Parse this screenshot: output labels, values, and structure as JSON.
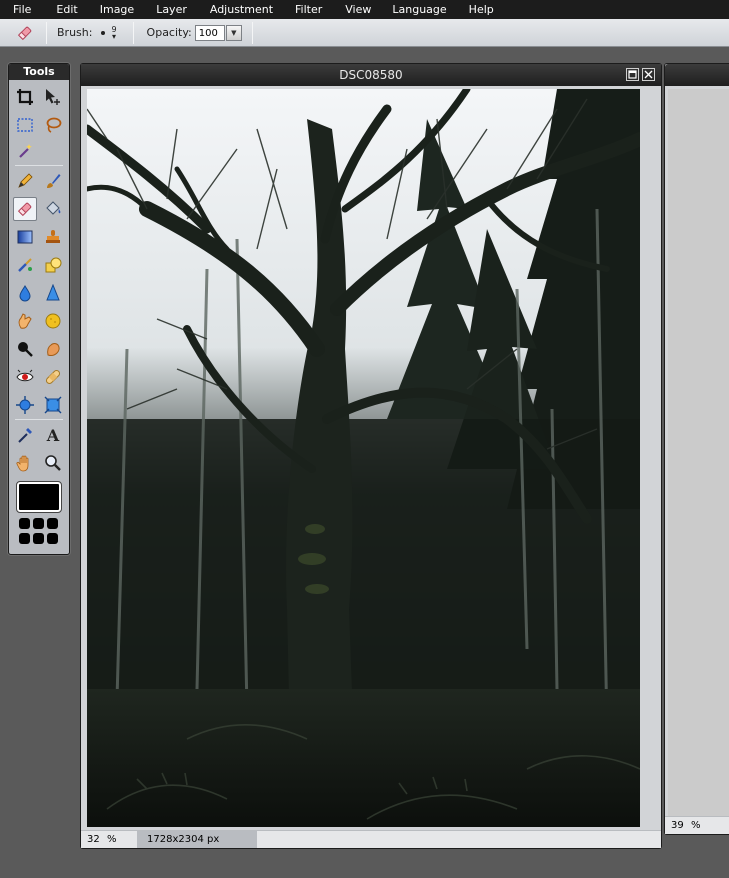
{
  "menu": [
    "File",
    "Edit",
    "Image",
    "Layer",
    "Adjustment",
    "Filter",
    "View",
    "Language",
    "Help"
  ],
  "options": {
    "brush_label": "Brush:",
    "brush_size": "9",
    "opacity_label": "Opacity:",
    "opacity_value": "100"
  },
  "tools": {
    "title": "Tools"
  },
  "document": {
    "title": "DSC08580",
    "zoom": "32",
    "zoom_unit": "%",
    "dimensions": "1728x2304 px"
  },
  "document2": {
    "zoom": "39",
    "zoom_unit": "%"
  },
  "colors": {
    "primary": "#000000"
  }
}
